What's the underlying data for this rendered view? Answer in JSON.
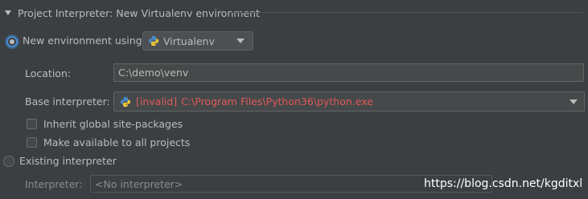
{
  "section": {
    "title": "Project Interpreter: New Virtualenv environment"
  },
  "new_env": {
    "label": "New environment using",
    "tool": "Virtualenv",
    "location": {
      "label": "Location:",
      "value": "C:\\demo\\venv"
    },
    "base_interpreter": {
      "label": "Base interpreter:",
      "invalid_tag": "[invalid]",
      "value": "C:\\Program Files\\Python36\\python.exe"
    },
    "inherit_label": "Inherit global site-packages",
    "make_available_label": "Make available to all projects"
  },
  "existing": {
    "label": "Existing interpreter",
    "interpreter_label": "Interpreter:",
    "interpreter_value": "<No interpreter>"
  },
  "watermark": "https://blog.csdn.net/kgditxl",
  "colors": {
    "background": "#3c3f41",
    "accent": "#4a88c7",
    "invalid": "#e0595a"
  }
}
